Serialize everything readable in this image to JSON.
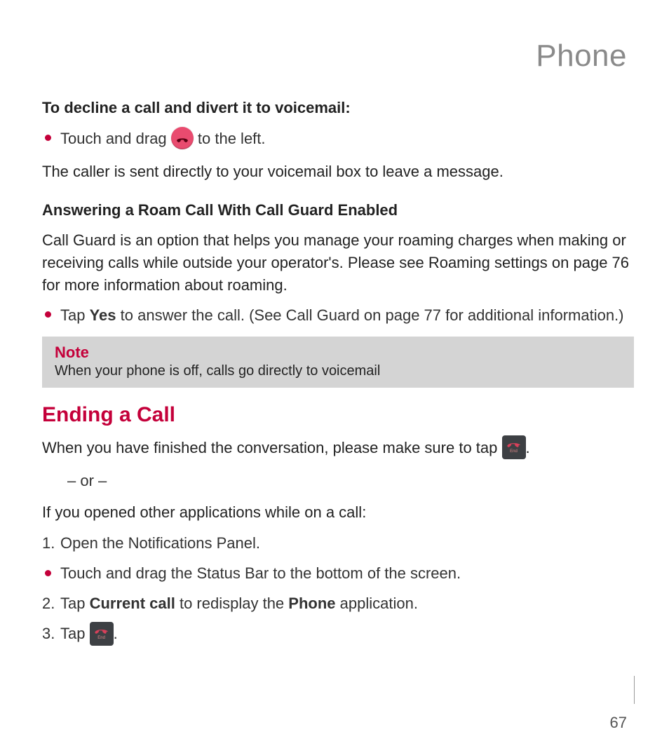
{
  "section_header": "Phone",
  "decline": {
    "subhead": "To decline a call and divert it to voicemail:",
    "b1_pre": "Touch and drag ",
    "b1_post": " to the left.",
    "result": "The caller is sent directly to your voicemail box to leave a message."
  },
  "roam": {
    "subhead": "Answering a Roam Call With Call Guard Enabled",
    "body": "Call Guard is an option that helps you manage your roaming charges when making or receiving calls while outside your operator's. Please see Roaming settings on page 76 for more information about roaming.",
    "b1_pre": "Tap ",
    "b1_yes": "Yes",
    "b1_post": " to answer the call. (See Call Guard on page 77 for additional information.)"
  },
  "note": {
    "title": "Note",
    "body": "When your phone is off, calls go directly to voicemail"
  },
  "ending": {
    "title": "Ending a Call",
    "p1_pre": "When you have finished the conversation, please make sure to tap ",
    "p1_post": ".",
    "or": "– or –",
    "p2": "If you opened other applications while on a call:",
    "s1": "Open the Notifications Panel.",
    "s1b": "Touch and drag the Status Bar to the bottom of the screen.",
    "s2_pre": "Tap ",
    "s2_b1": "Current call",
    "s2_mid": " to redisplay the ",
    "s2_b2": "Phone",
    "s2_post": " application.",
    "s3_pre": "Tap ",
    "s3_post": ".",
    "end_label": "End"
  },
  "page_number": "67"
}
